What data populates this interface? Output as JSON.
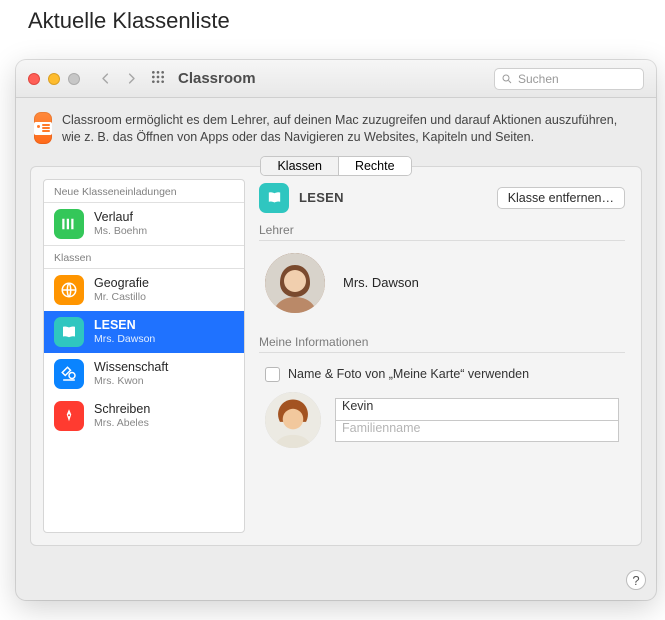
{
  "annotation": "Aktuelle Klassenliste",
  "titlebar": {
    "app_name": "Classroom",
    "search_placeholder": "Suchen"
  },
  "description": "Classroom ermöglicht es dem Lehrer, auf deinen Mac zuzugreifen und darauf Aktionen auszuführen, wie z. B. das Öffnen von Apps oder das Navigieren zu Websites, Kapiteln und Seiten.",
  "tabs": {
    "classes": "Klassen",
    "permissions": "Rechte",
    "active": 0
  },
  "sidebar": {
    "section_invites": "Neue Klasseneinladungen",
    "section_classes": "Klassen",
    "invites": [
      {
        "title": "Verlauf",
        "sub": "Ms. Boehm",
        "color": "#34c759",
        "icon": "columns"
      }
    ],
    "classes": [
      {
        "title": "Geografie",
        "sub": "Mr. Castillo",
        "color": "#ff9500",
        "icon": "globe"
      },
      {
        "title": "LESEN",
        "sub": "Mrs. Dawson",
        "color": "#2fc6c0",
        "icon": "book",
        "selected": true
      },
      {
        "title": "Wissenschaft",
        "sub": "Mrs. Kwon",
        "color": "#0a84ff",
        "icon": "microscope"
      },
      {
        "title": "Schreiben",
        "sub": "Mrs. Abeles",
        "color": "#ff3b30",
        "icon": "pen"
      }
    ]
  },
  "detail": {
    "class_title": "LESEN",
    "remove_label": "Klasse entfernen…",
    "teacher_section": "Lehrer",
    "teacher_name": "Mrs. Dawson",
    "myinfo_section": "Meine Informationen",
    "use_card_label": "Name & Foto von „Meine Karte“ verwenden",
    "first_name_value": "Kevin",
    "last_name_placeholder": "Familienname"
  }
}
